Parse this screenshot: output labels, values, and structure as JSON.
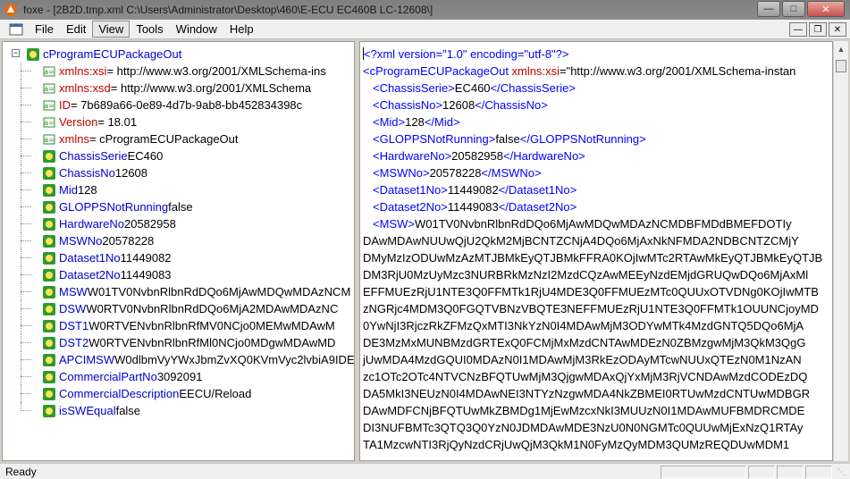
{
  "window": {
    "title": "foxe - [2B2D.tmp.xml  C:\\Users\\Administrator\\Desktop\\460\\E-ECU EC460B LC-12608\\]"
  },
  "menu": [
    "File",
    "Edit",
    "View",
    "Tools",
    "Window",
    "Help"
  ],
  "tree": {
    "root_name": "cProgramECUPackageOut",
    "nodes": [
      {
        "kind": "attr",
        "name": "xmlns:xsi",
        "value": " = http://www.w3.org/2001/XMLSchema-ins"
      },
      {
        "kind": "attr",
        "name": "xmlns:xsd",
        "value": " = http://www.w3.org/2001/XMLSchema"
      },
      {
        "kind": "attr",
        "name": "ID",
        "value": " = 7b689a66-0e89-4d7b-9ab8-bb452834398c"
      },
      {
        "kind": "attr",
        "name": "Version",
        "value": " = 18.01"
      },
      {
        "kind": "attr",
        "name": "xmlns",
        "value": " = cProgramECUPackageOut"
      },
      {
        "kind": "elem",
        "name": "ChassisSerie",
        "value": " EC460"
      },
      {
        "kind": "elem",
        "name": "ChassisNo",
        "value": " 12608"
      },
      {
        "kind": "elem",
        "name": "Mid",
        "value": " 128"
      },
      {
        "kind": "elem",
        "name": "GLOPPSNotRunning",
        "value": " false"
      },
      {
        "kind": "elem",
        "name": "HardwareNo",
        "value": " 20582958"
      },
      {
        "kind": "elem",
        "name": "MSWNo",
        "value": " 20578228"
      },
      {
        "kind": "elem",
        "name": "Dataset1No",
        "value": " 11449082"
      },
      {
        "kind": "elem",
        "name": "Dataset2No",
        "value": " 11449083"
      },
      {
        "kind": "elem",
        "name": "MSW",
        "value": " W01TV0NvbnRlbnRdDQo6MjAwMDQwMDAzNCM"
      },
      {
        "kind": "elem",
        "name": "DSW",
        "value": " W0RTV0NvbnRlbnRdDQo6MjA2MDAwMDAzNC"
      },
      {
        "kind": "elem",
        "name": "DST1",
        "value": " W0RTVENvbnRlbnRfMV0NCjo0MEMwMDAwM"
      },
      {
        "kind": "elem",
        "name": "DST2",
        "value": " W0RTVENvbnRlbnRfMl0NCjo0MDgwMDAwMD"
      },
      {
        "kind": "elem",
        "name": "APCIMSW",
        "value": " W0dlbmVyYWxJbmZvXQ0KVmVyc2lvbiA9IDE"
      },
      {
        "kind": "elem",
        "name": "CommercialPartNo",
        "value": " 3092091"
      },
      {
        "kind": "elem",
        "name": "CommercialDescription",
        "value": " EECU/Reload"
      },
      {
        "kind": "elem",
        "name": "isSWEqual",
        "value": " false"
      }
    ]
  },
  "xml": {
    "decl": "<?xml version=\"1.0\" encoding=\"utf-8\"?>",
    "root_open": "<cProgramECUPackageOut",
    "root_attr_name": " xmlns:xsi",
    "root_attr_rest": "=\"http://www.w3.org/2001/XMLSchema-instan",
    "elements": [
      {
        "name": "ChassisSerie",
        "value": "EC460"
      },
      {
        "name": "ChassisNo",
        "value": "12608"
      },
      {
        "name": "Mid",
        "value": "128"
      },
      {
        "name": "GLOPPSNotRunning",
        "value": "false"
      },
      {
        "name": "HardwareNo",
        "value": "20582958"
      },
      {
        "name": "MSWNo",
        "value": "20578228"
      },
      {
        "name": "Dataset1No",
        "value": "11449082"
      },
      {
        "name": "Dataset2No",
        "value": "11449083"
      }
    ],
    "msw_open": "<MSW>",
    "msw_first": "W01TV0NvbnRlbnRdDQo6MjAwMDQwMDAzNCMDBFMDdBMEFDOTIy",
    "msw_lines": [
      "DAwMDAwNUUwQjU2QkM2MjBCNTZCNjA4DQo6MjAxNkNFMDA2NDBCNTZCMjY",
      "DMyMzIzODUwMzAzMTJBMkEyQTJBMkFFRA0KOjIwMTc2RTAwMkEyQTJBMkEyQTJB",
      "DM3RjU0MzUyMzc3NURBRkMzNzI2MzdCQzAwMEEyNzdEMjdGRUQwDQo6MjAxMl",
      "EFFMUEzRjU1NTE3Q0FFMTk1RjU4MDE3Q0FFMUEzMTc0QUUxOTVDNg0KOjIwMTB",
      "zNGRjc4MDM3Q0FGQTVBNzVBQTE3NEFFMUEzRjU1NTE3Q0FFMTk1OUUNCjoyMD",
      "0YwNjI3RjczRkZFMzQxMTI3NkYzN0I4MDAwMjM3ODYwMTk4MzdGNTQ5DQo6MjA",
      "DE3MzMxMUNBMzdGRTExQ0FCMjMxMzdCNTAwMDEzN0ZBMzgwMjM3QkM3QgG",
      "jUwMDA4MzdGQUI0MDAzN0I1MDAwMjM3RkEzODAyMTcwNUUxQTEzN0M1NzAN",
      "zc1OTc2OTc4NTVCNzBFQTUwMjM3QjgwMDAxQjYxMjM3RjVCNDAwMzdCODEzDQ",
      "DA5MkI3NEUzN0I4MDAwNEI3NTYzNzgwMDA4NkZBMEI0RTUwMzdCNTUwMDBGR",
      "DAwMDFCNjBFQTUwMkZBMDg1MjEwMzcxNkI3MUUzN0I1MDAwMUFBMDRCMDE",
      "DI3NUFBMTc3QTQ3Q0YzN0JDMDAwMDE3NzU0N0NGMTc0QUUwMjExNzQ1RTAy",
      "TA1MzcwNTI3RjQyNzdCRjUwQjM3QkM1N0FyMzQyMDM3QUMzREQDUwMDM1"
    ]
  },
  "status": {
    "text": "Ready"
  }
}
